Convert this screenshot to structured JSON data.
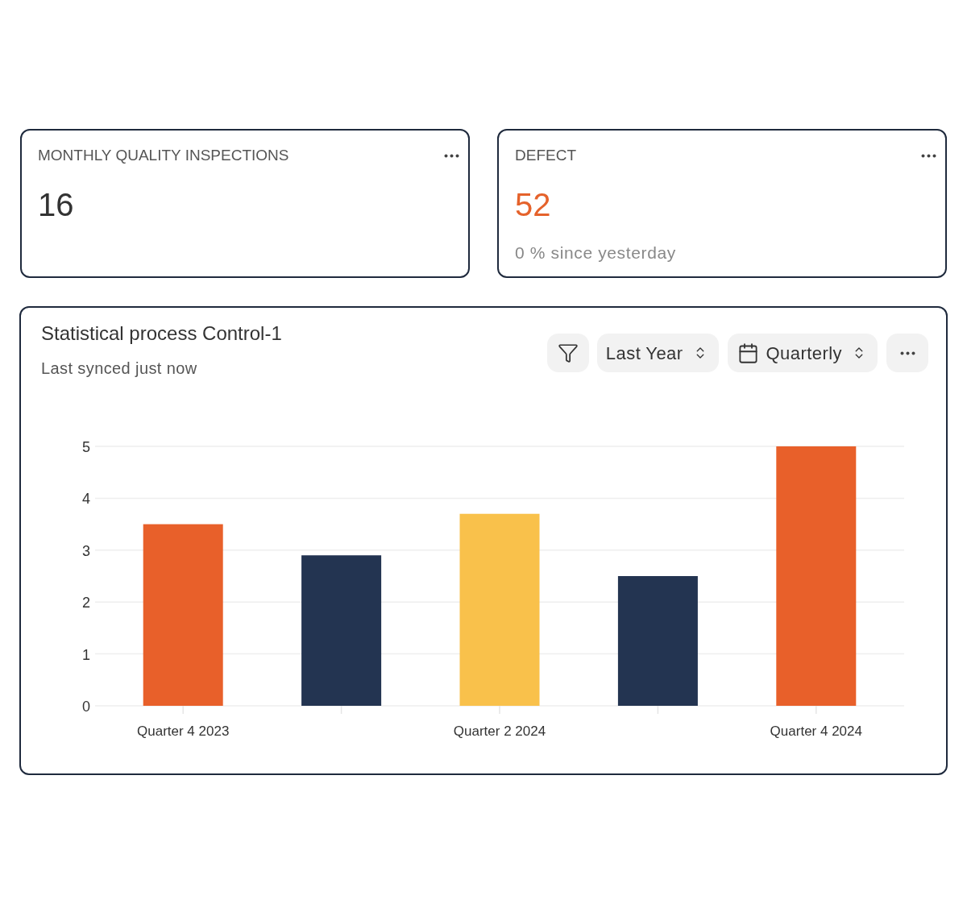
{
  "kpi_cards": [
    {
      "title": "MONTHLY QUALITY INSPECTIONS",
      "value": "16",
      "color": "#333333"
    },
    {
      "title": "DEFECT",
      "value": "52",
      "color": "#e5622b",
      "caption": "0 % since yesterday"
    }
  ],
  "chart_panel": {
    "title": "Statistical process Control-1",
    "subtitle": "Last synced just now",
    "period_select": {
      "value": "Last Year"
    },
    "interval_select": {
      "value": "Quarterly"
    },
    "chart_data": {
      "type": "bar",
      "categories": [
        "Quarter 4 2023",
        null,
        "Quarter 2 2024",
        null,
        "Quarter 4 2024"
      ],
      "values": [
        3.5,
        2.9,
        3.7,
        2.5,
        5
      ],
      "colors": [
        "#e8602a",
        "#233451",
        "#f9c14b",
        "#233451",
        "#e8602a"
      ],
      "ylim": [
        0,
        5
      ],
      "yticks": [
        0,
        1,
        2,
        3,
        4,
        5
      ],
      "grid": true
    }
  }
}
